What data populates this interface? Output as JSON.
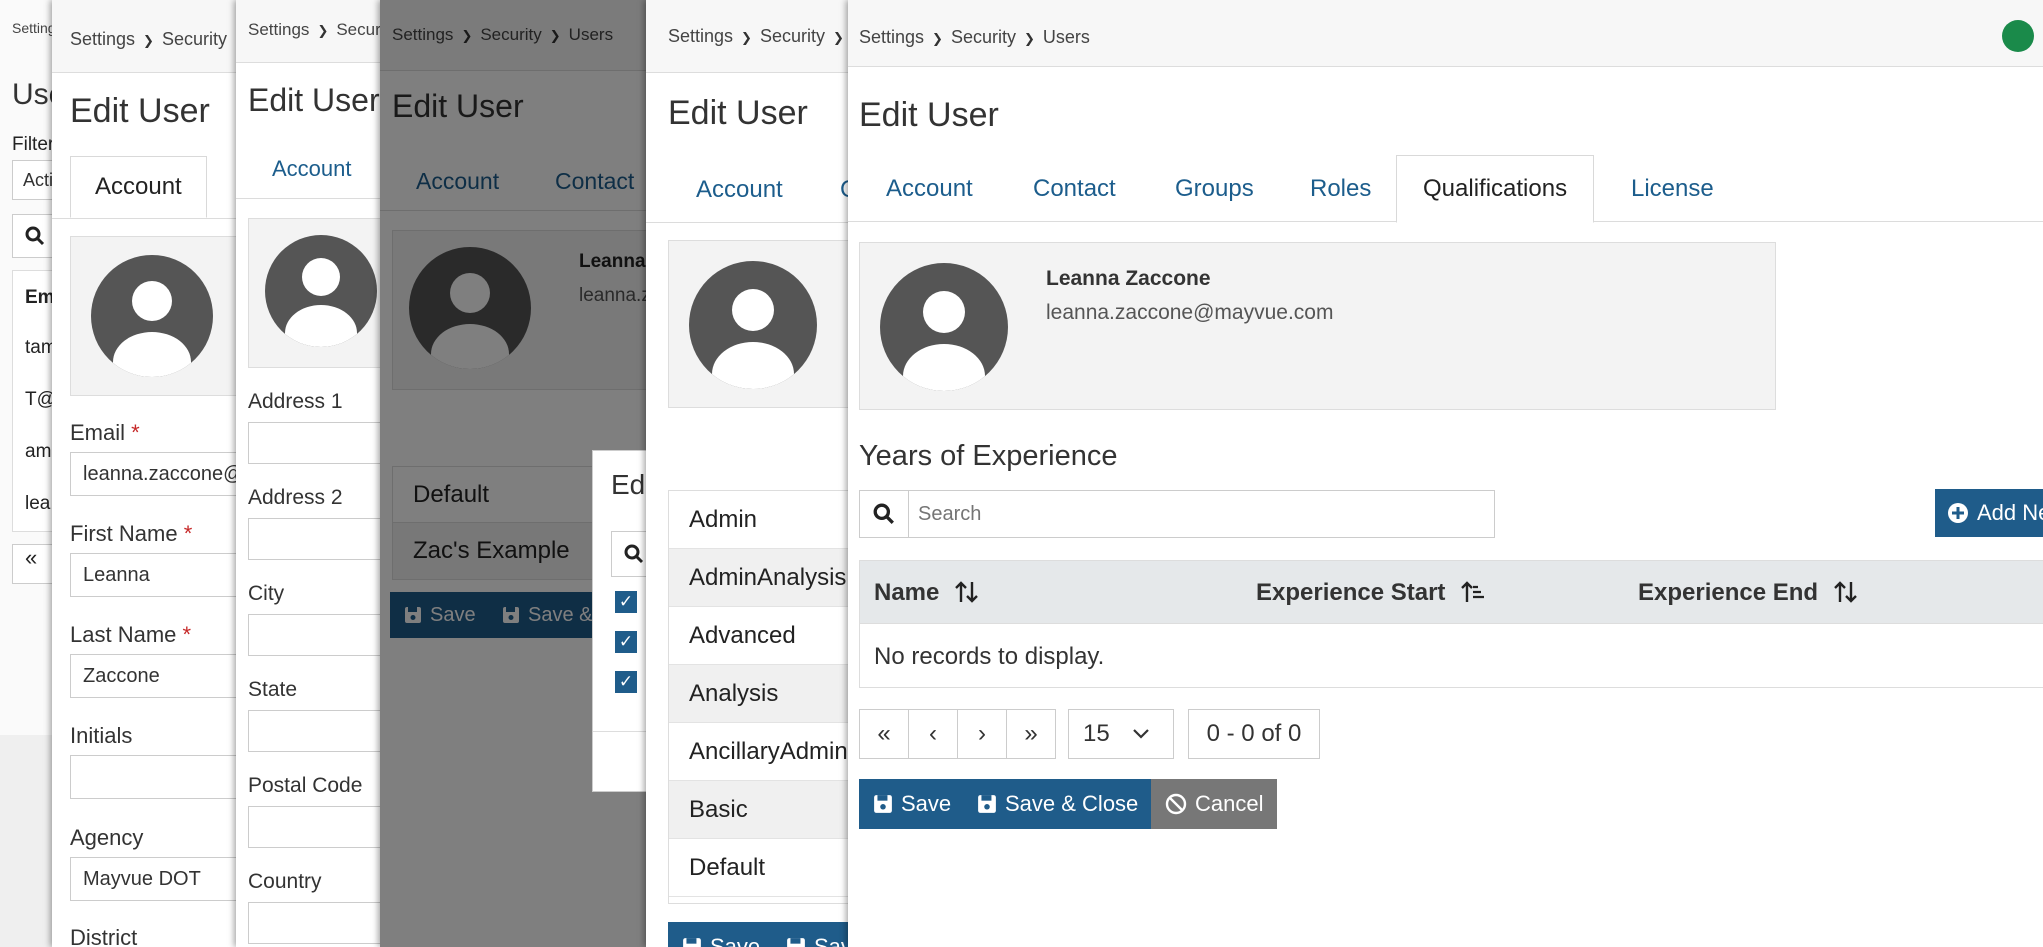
{
  "breadcrumb": {
    "settings": "Settings",
    "security": "Security",
    "users": "Users"
  },
  "page_title_users": "Users",
  "title": "Edit User",
  "tabs": {
    "account": "Account",
    "contact": "Contact",
    "groups": "Groups",
    "roles": "Roles",
    "qualifications": "Qualifications",
    "license": "License"
  },
  "panel0": {
    "filter_label": "Filter",
    "filter_value": "Active",
    "col_email": "Email",
    "rows": [
      "tam",
      "T@",
      "am",
      "lea"
    ],
    "pager_first": "«"
  },
  "account_form": {
    "email_label": "Email",
    "email_value": "leanna.zaccone@mayvue.com",
    "first_name_label": "First Name",
    "first_name_value": "Leanna",
    "last_name_label": "Last Name",
    "last_name_value": "Zaccone",
    "initials_label": "Initials",
    "agency_label": "Agency",
    "agency_value": "Mayvue DOT",
    "district_label": "District",
    "required_mark": "*"
  },
  "contact_form": {
    "address1_label": "Address 1",
    "address2_label": "Address 2",
    "city_label": "City",
    "state_label": "State",
    "postal_label": "Postal Code",
    "country_label": "Country"
  },
  "groups_panel": {
    "rows": [
      "Default",
      "Zac's Example"
    ],
    "dialog_title": "Ed"
  },
  "roles_list": [
    "Admin",
    "AdminAnalysis",
    "Advanced",
    "Analysis",
    "AncillaryAdmin",
    "Basic",
    "Default"
  ],
  "user": {
    "name": "Leanna Zaccone",
    "email": "leanna.zaccone@mayvue.com"
  },
  "qualifications": {
    "section_title": "Years of Experience",
    "search_placeholder": "Search",
    "add_button": "Add New",
    "columns": {
      "name": "Name",
      "start": "Experience Start",
      "end": "Experience End"
    },
    "empty_message": "No records to display.",
    "pager": {
      "first": "«",
      "prev": "‹",
      "next": "›",
      "last": "»",
      "page_size": "15",
      "range": "0 - 0 of 0"
    }
  },
  "buttons": {
    "save": "Save",
    "save_close": "Save & Close",
    "cancel": "Cancel"
  },
  "colors": {
    "accent": "#1f5c8a",
    "link": "#1c5d8c",
    "status_dot": "#1a8a4a",
    "cancel": "#777777"
  }
}
